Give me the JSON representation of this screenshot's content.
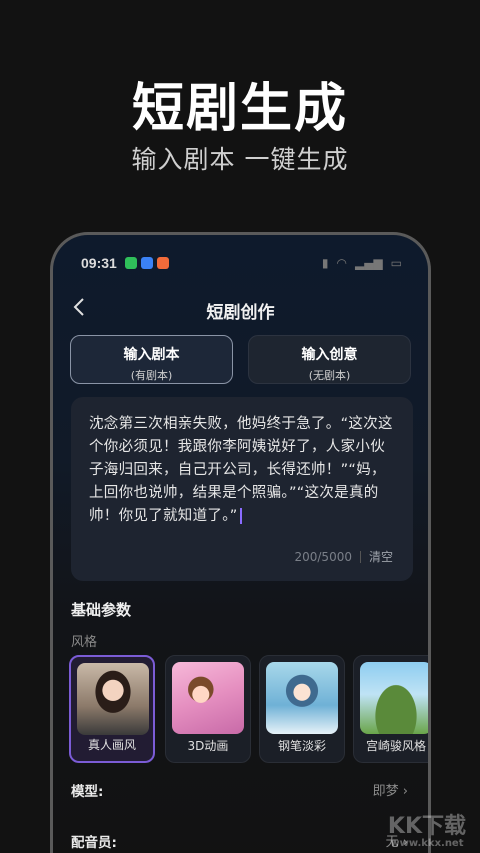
{
  "hero": {
    "title": "短剧生成",
    "subtitle": "输入剧本 一键生成"
  },
  "status_bar": {
    "time": "09:31"
  },
  "header": {
    "back_icon": "chevron-left",
    "title": "短剧创作"
  },
  "tabs": [
    {
      "label": "输入剧本",
      "sub": "(有剧本)",
      "active": true
    },
    {
      "label": "输入创意",
      "sub": "(无剧本)",
      "active": false
    }
  ],
  "script": {
    "text": "沈念第三次相亲失败，他妈终于急了。“这次这个你必须见！我跟你李阿姨说好了，人家小伙子海归回来，自己开公司，长得还帅！”“妈，上回你也说帅，结果是个照骗。”“这次是真的帅！你见了就知道了。”",
    "counter": "200/5000",
    "clear_label": "清空"
  },
  "basic_params": {
    "title": "基础参数",
    "style_label": "风格",
    "styles": [
      {
        "name": "真人画风",
        "selected": true
      },
      {
        "name": "3D动画",
        "selected": false
      },
      {
        "name": "钢笔淡彩",
        "selected": false
      },
      {
        "name": "宫崎骏风格",
        "selected": false
      }
    ],
    "model": {
      "label": "模型:",
      "value": "即梦"
    },
    "voice": {
      "label": "配音员:",
      "value": "无"
    }
  },
  "watermark": {
    "text": "KK下载",
    "url": "www.kkx.net"
  },
  "colors": {
    "accent": "#7b5cd6",
    "background": "#121212"
  }
}
